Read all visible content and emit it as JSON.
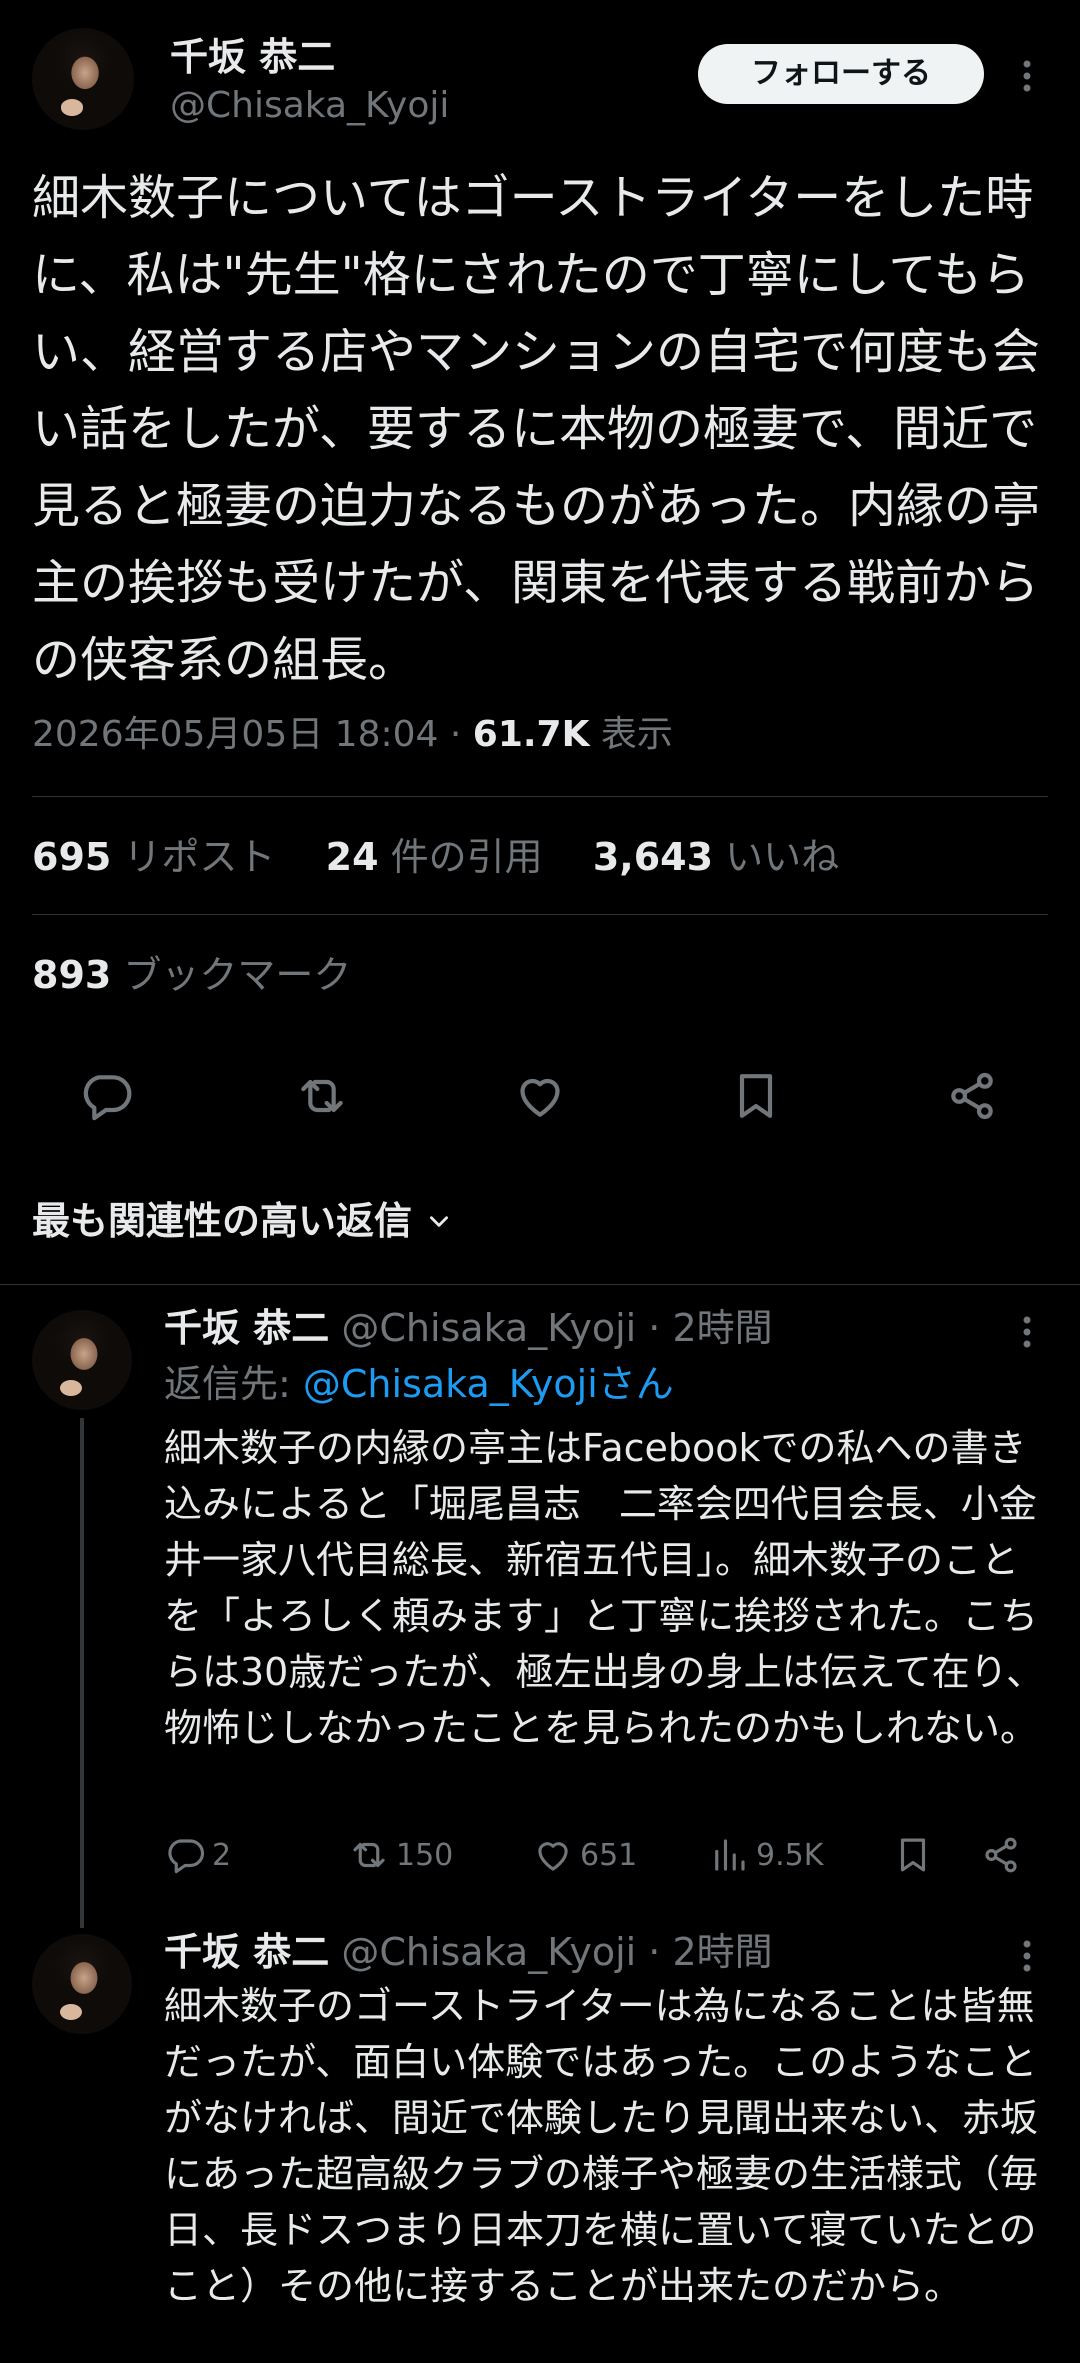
{
  "tweet": {
    "display_name": "千坂 恭二",
    "handle": "@Chisaka_Kyoji",
    "follow_label": "フォローする",
    "text": "細木数子についてはゴーストライターをした時に、私は\"先生\"格にされたので丁寧にしてもらい、経営する店やマンションの自宅で何度も会い話をしたが、要するに本物の極妻で、間近で見ると極妻の迫力なるものがあった。内縁の亭主の挨拶も受けたが、関東を代表する戦前からの侠客系の組長。",
    "timestamp": "2026年05月05日 18:04 · ",
    "views_count": "61.7K",
    "views_label": " 表示"
  },
  "stats": {
    "reposts_count": "695",
    "reposts_label": "リポスト",
    "quotes_count": "24",
    "quotes_label": "件の引用",
    "likes_count": "3,643",
    "likes_label": "いいね",
    "bookmarks_count": "893",
    "bookmarks_label": "ブックマーク"
  },
  "actions": {
    "icons": [
      "reply-icon",
      "repost-icon",
      "like-icon",
      "bookmark-icon",
      "share-icon"
    ]
  },
  "replies_header": {
    "label": "最も関連性の高い返信"
  },
  "replies": [
    {
      "display_name": "千坂 恭二",
      "handle": "@Chisaka_Kyoji",
      "time": " · 2時間",
      "reply_to_prefix": "返信先: ",
      "reply_to_handle": "@Chisaka_Kyojiさん",
      "text": "細木数子の内縁の亭主はFacebookでの私への書き込みによると「堀尾昌志　二率会四代目会長、小金井一家八代目総長、新宿五代目」。細木数子のことを「よろしく頼みます」と丁寧に挨拶された。こちらは30歳だったが、極左出身の身上は伝えて在り、物怖じしなかったことを見られたのかもしれない。",
      "reply_count": "2",
      "repost_count": "150",
      "like_count": "651",
      "view_count": "9.5K"
    },
    {
      "display_name": "千坂 恭二",
      "handle": "@Chisaka_Kyoji",
      "time": " · 2時間",
      "text": "細木数子のゴーストライターは為になることは皆無だったが、面白い体験ではあった。このようなことがなければ、間近で体験したり見聞出来ない、赤坂にあった超高級クラブの様子や極妻の生活様式（毎日、長ドスつまり日本刀を横に置いて寝ていたとのこと）その他に接することが出来たのだから。"
    }
  ],
  "colors": {
    "background": "#000000",
    "text": "#e7e9ea",
    "muted": "#71767b",
    "link": "#1d9bf0",
    "divider": "#2f3336"
  }
}
